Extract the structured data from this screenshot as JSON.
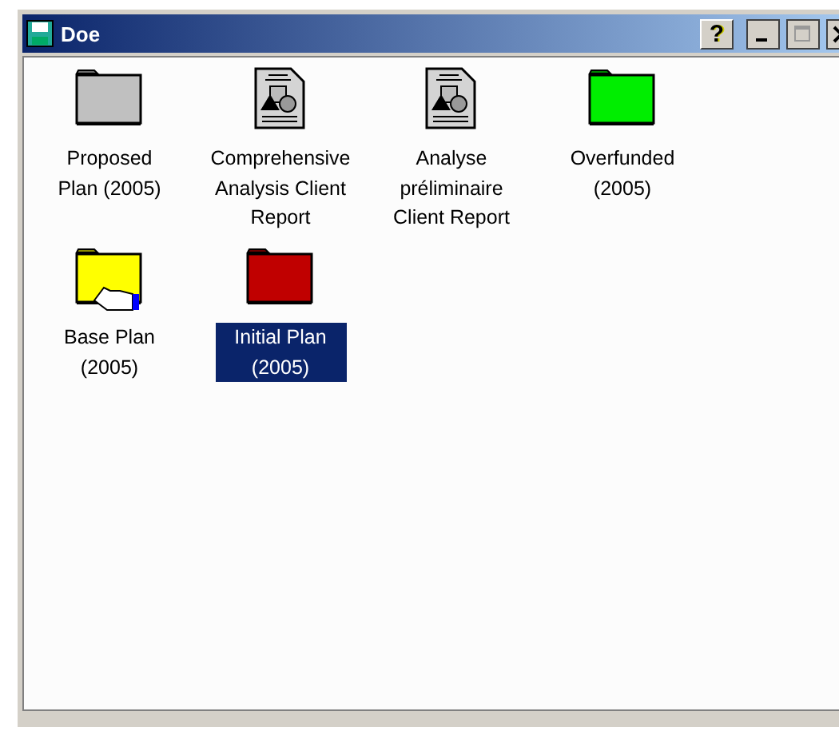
{
  "window": {
    "title": "Doe",
    "help_button": "?"
  },
  "items": [
    {
      "kind": "folder",
      "color": "#c0c0c0",
      "label": "Proposed Plan (2005)",
      "shared": false,
      "selected": false
    },
    {
      "kind": "document",
      "label": "Comprehensive Analysis Client Report",
      "selected": false
    },
    {
      "kind": "document",
      "label": "Analyse préliminaire Client Report",
      "selected": false
    },
    {
      "kind": "folder",
      "color": "#00ee00",
      "label": "Overfunded (2005)",
      "shared": false,
      "selected": false
    },
    {
      "kind": "folder",
      "color": "#ffff00",
      "label": "Base Plan (2005)",
      "shared": true,
      "selected": false
    },
    {
      "kind": "folder",
      "color": "#c00000",
      "label": "Initial Plan (2005)",
      "shared": false,
      "selected": true
    }
  ]
}
